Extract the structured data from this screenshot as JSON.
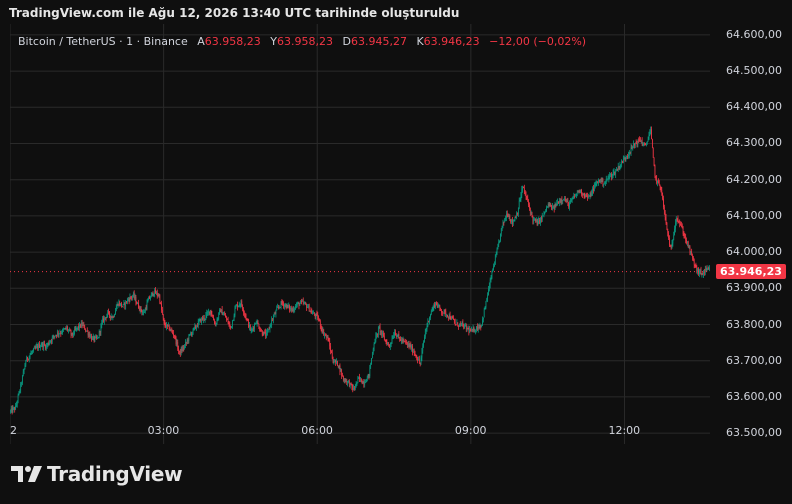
{
  "header": {
    "title": "TradingView.com ile Ağu 12, 2026 13:40 UTC tarihinde oluşturuldu"
  },
  "legend": {
    "symbol": "Bitcoin / TetherUS · 1 · Binance",
    "open_label": "A",
    "open_value": "63.958,23",
    "high_label": "Y",
    "high_value": "63.958,23",
    "low_label": "D",
    "low_value": "63.945,27",
    "close_label": "K",
    "close_value": "63.946,23",
    "change": "−12,00 (−0,02%)"
  },
  "last_price": "63.946,23",
  "logo": {
    "text": "TradingView",
    "icon": "tradingview-logo-icon"
  },
  "colors": {
    "up": "#089981",
    "down": "#f23645",
    "grid": "#2a2a2a",
    "background": "#0f0f0f"
  },
  "chart_data": {
    "type": "candlestick",
    "y_ticks": [
      "64.600,00",
      "64.500,00",
      "64.400,00",
      "64.300,00",
      "64.200,00",
      "64.100,00",
      "64.000,00",
      "63.900,00",
      "63.800,00",
      "63.700,00",
      "63.600,00",
      "63.500,00"
    ],
    "y_tick_values": [
      64600,
      64500,
      64400,
      64300,
      64200,
      64100,
      64000,
      63900,
      63800,
      63700,
      63600,
      63500
    ],
    "ylim": [
      63470,
      64630
    ],
    "x_ticks": [
      "2",
      "03:00",
      "06:00",
      "09:00",
      "12:00"
    ],
    "x_tick_hours": [
      0,
      3,
      6,
      9,
      12
    ],
    "xlim_hours": [
      0,
      13.67
    ],
    "last_price_value": 63946.23,
    "interval": "1",
    "series": [
      {
        "name": "Bitcoin / TetherUS",
        "points": [
          [
            0.0,
            63560
          ],
          [
            0.1,
            63570
          ],
          [
            0.2,
            63630
          ],
          [
            0.3,
            63700
          ],
          [
            0.4,
            63720
          ],
          [
            0.5,
            63735
          ],
          [
            0.6,
            63745
          ],
          [
            0.7,
            63740
          ],
          [
            0.8,
            63760
          ],
          [
            0.9,
            63775
          ],
          [
            1.0,
            63780
          ],
          [
            1.1,
            63790
          ],
          [
            1.2,
            63770
          ],
          [
            1.3,
            63790
          ],
          [
            1.4,
            63800
          ],
          [
            1.5,
            63780
          ],
          [
            1.6,
            63760
          ],
          [
            1.7,
            63760
          ],
          [
            1.8,
            63810
          ],
          [
            1.9,
            63830
          ],
          [
            2.0,
            63820
          ],
          [
            2.1,
            63860
          ],
          [
            2.2,
            63850
          ],
          [
            2.3,
            63870
          ],
          [
            2.4,
            63880
          ],
          [
            2.5,
            63850
          ],
          [
            2.6,
            63830
          ],
          [
            2.7,
            63870
          ],
          [
            2.8,
            63890
          ],
          [
            2.9,
            63880
          ],
          [
            3.0,
            63800
          ],
          [
            3.1,
            63790
          ],
          [
            3.2,
            63770
          ],
          [
            3.3,
            63720
          ],
          [
            3.4,
            63740
          ],
          [
            3.5,
            63770
          ],
          [
            3.6,
            63790
          ],
          [
            3.7,
            63810
          ],
          [
            3.8,
            63820
          ],
          [
            3.9,
            63840
          ],
          [
            4.0,
            63800
          ],
          [
            4.1,
            63840
          ],
          [
            4.2,
            63820
          ],
          [
            4.3,
            63790
          ],
          [
            4.4,
            63850
          ],
          [
            4.5,
            63860
          ],
          [
            4.6,
            63820
          ],
          [
            4.7,
            63780
          ],
          [
            4.8,
            63810
          ],
          [
            4.9,
            63780
          ],
          [
            5.0,
            63770
          ],
          [
            5.1,
            63810
          ],
          [
            5.2,
            63840
          ],
          [
            5.3,
            63860
          ],
          [
            5.4,
            63850
          ],
          [
            5.5,
            63840
          ],
          [
            5.6,
            63855
          ],
          [
            5.7,
            63860
          ],
          [
            5.8,
            63850
          ],
          [
            5.9,
            63830
          ],
          [
            6.0,
            63820
          ],
          [
            6.1,
            63780
          ],
          [
            6.2,
            63760
          ],
          [
            6.3,
            63700
          ],
          [
            6.4,
            63690
          ],
          [
            6.5,
            63650
          ],
          [
            6.6,
            63640
          ],
          [
            6.7,
            63620
          ],
          [
            6.8,
            63650
          ],
          [
            6.9,
            63640
          ],
          [
            7.0,
            63660
          ],
          [
            7.1,
            63750
          ],
          [
            7.2,
            63790
          ],
          [
            7.3,
            63760
          ],
          [
            7.4,
            63740
          ],
          [
            7.5,
            63780
          ],
          [
            7.6,
            63760
          ],
          [
            7.7,
            63750
          ],
          [
            7.8,
            63740
          ],
          [
            7.9,
            63720
          ],
          [
            8.0,
            63690
          ],
          [
            8.1,
            63780
          ],
          [
            8.2,
            63830
          ],
          [
            8.3,
            63860
          ],
          [
            8.4,
            63840
          ],
          [
            8.5,
            63830
          ],
          [
            8.6,
            63820
          ],
          [
            8.7,
            63800
          ],
          [
            8.8,
            63800
          ],
          [
            8.9,
            63790
          ],
          [
            9.0,
            63780
          ],
          [
            9.1,
            63790
          ],
          [
            9.2,
            63800
          ],
          [
            9.3,
            63870
          ],
          [
            9.4,
            63940
          ],
          [
            9.5,
            64000
          ],
          [
            9.6,
            64070
          ],
          [
            9.7,
            64110
          ],
          [
            9.8,
            64080
          ],
          [
            9.9,
            64110
          ],
          [
            10.0,
            64180
          ],
          [
            10.1,
            64140
          ],
          [
            10.2,
            64090
          ],
          [
            10.3,
            64080
          ],
          [
            10.4,
            64100
          ],
          [
            10.5,
            64130
          ],
          [
            10.6,
            64120
          ],
          [
            10.7,
            64140
          ],
          [
            10.8,
            64150
          ],
          [
            10.9,
            64130
          ],
          [
            11.0,
            64150
          ],
          [
            11.1,
            64170
          ],
          [
            11.2,
            64160
          ],
          [
            11.3,
            64150
          ],
          [
            11.4,
            64180
          ],
          [
            11.5,
            64200
          ],
          [
            11.6,
            64190
          ],
          [
            11.7,
            64210
          ],
          [
            11.8,
            64220
          ],
          [
            11.9,
            64240
          ],
          [
            12.0,
            64260
          ],
          [
            12.1,
            64280
          ],
          [
            12.2,
            64300
          ],
          [
            12.3,
            64310
          ],
          [
            12.4,
            64290
          ],
          [
            12.5,
            64340
          ],
          [
            12.55,
            64260
          ],
          [
            12.6,
            64200
          ],
          [
            12.7,
            64180
          ],
          [
            12.8,
            64080
          ],
          [
            12.9,
            64000
          ],
          [
            13.0,
            64100
          ],
          [
            13.1,
            64070
          ],
          [
            13.2,
            64030
          ],
          [
            13.3,
            63990
          ],
          [
            13.4,
            63950
          ],
          [
            13.5,
            63940
          ],
          [
            13.6,
            63950
          ]
        ]
      }
    ]
  }
}
